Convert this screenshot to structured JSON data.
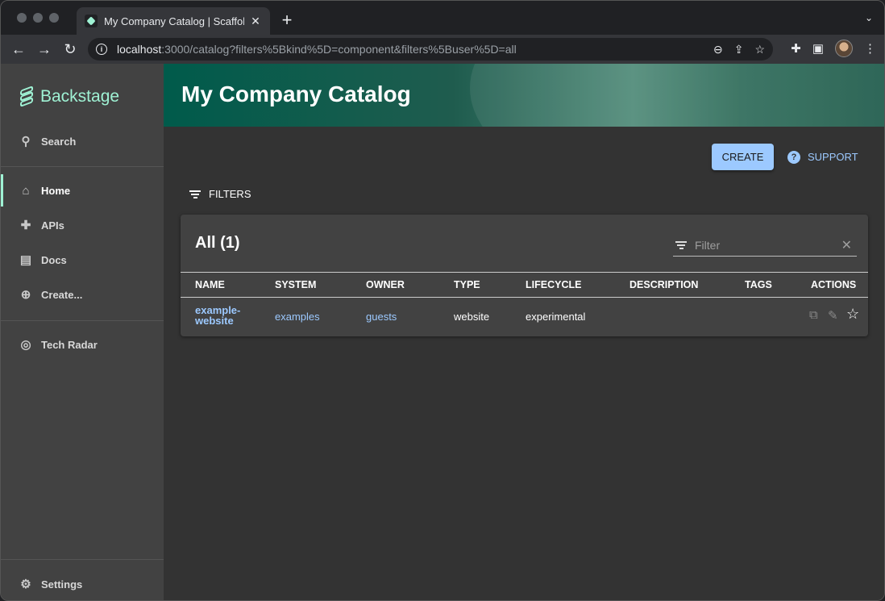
{
  "browser": {
    "tab_title": "My Company Catalog | Scaffold",
    "url_host": "localhost",
    "url_rest": ":3000/catalog?filters%5Bkind%5D=component&filters%5Buser%5D=all"
  },
  "sidebar": {
    "brand": "Backstage",
    "items": [
      {
        "label": "Search",
        "icon": "search-icon"
      },
      {
        "label": "Home",
        "icon": "home-icon"
      },
      {
        "label": "APIs",
        "icon": "puzzle-icon"
      },
      {
        "label": "Docs",
        "icon": "library-icon"
      },
      {
        "label": "Create...",
        "icon": "add-circle-icon"
      },
      {
        "label": "Tech Radar",
        "icon": "radar-icon"
      },
      {
        "label": "Settings",
        "icon": "gear-icon"
      }
    ]
  },
  "header": {
    "title": "My Company Catalog"
  },
  "actions": {
    "create_label": "CREATE",
    "support_label": "SUPPORT",
    "filters_label": "FILTERS"
  },
  "table": {
    "title": "All (1)",
    "filter_placeholder": "Filter",
    "columns": [
      "NAME",
      "SYSTEM",
      "OWNER",
      "TYPE",
      "LIFECYCLE",
      "DESCRIPTION",
      "TAGS",
      "ACTIONS"
    ],
    "rows": [
      {
        "name_line1": "example-",
        "name_line2": "website",
        "system": "examples",
        "owner": "guests",
        "type": "website",
        "lifecycle": "experimental",
        "description": "",
        "tags": ""
      }
    ]
  },
  "colors": {
    "accent": "#9ff2d4",
    "link": "#9cc9ff",
    "header_bg": "#1f5c4e"
  }
}
